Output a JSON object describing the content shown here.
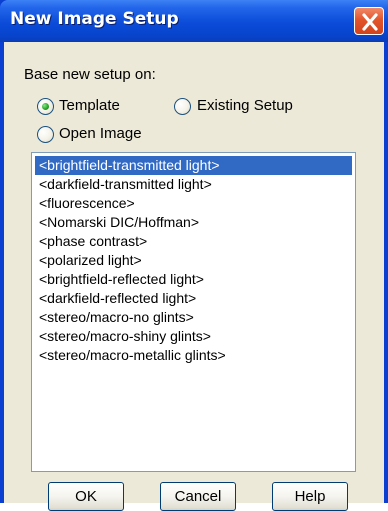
{
  "window": {
    "title": "New Image Setup"
  },
  "form": {
    "base_label": "Base new setup on:",
    "options": [
      {
        "label": "Template",
        "selected": true
      },
      {
        "label": "Existing Setup",
        "selected": false
      },
      {
        "label": "Open Image",
        "selected": false
      }
    ]
  },
  "list": {
    "items": [
      "<brightfield-transmitted light>",
      "<darkfield-transmitted light>",
      "<fluorescence>",
      "<Nomarski DIC/Hoffman>",
      "<phase contrast>",
      "<polarized light>",
      "<brightfield-reflected light>",
      "<darkfield-reflected light>",
      "<stereo/macro-no glints>",
      "<stereo/macro-shiny glints>",
      "<stereo/macro-metallic glints>"
    ],
    "selected_index": 0
  },
  "buttons": {
    "ok": "OK",
    "cancel": "Cancel",
    "help": "Help"
  },
  "colors": {
    "titlebar": "#0b4bd8",
    "selection": "#316ac5",
    "close": "#e2552b",
    "face": "#ece9d8"
  },
  "icons": {
    "close": "close-icon",
    "radio_dot": "radio-dot-icon"
  }
}
